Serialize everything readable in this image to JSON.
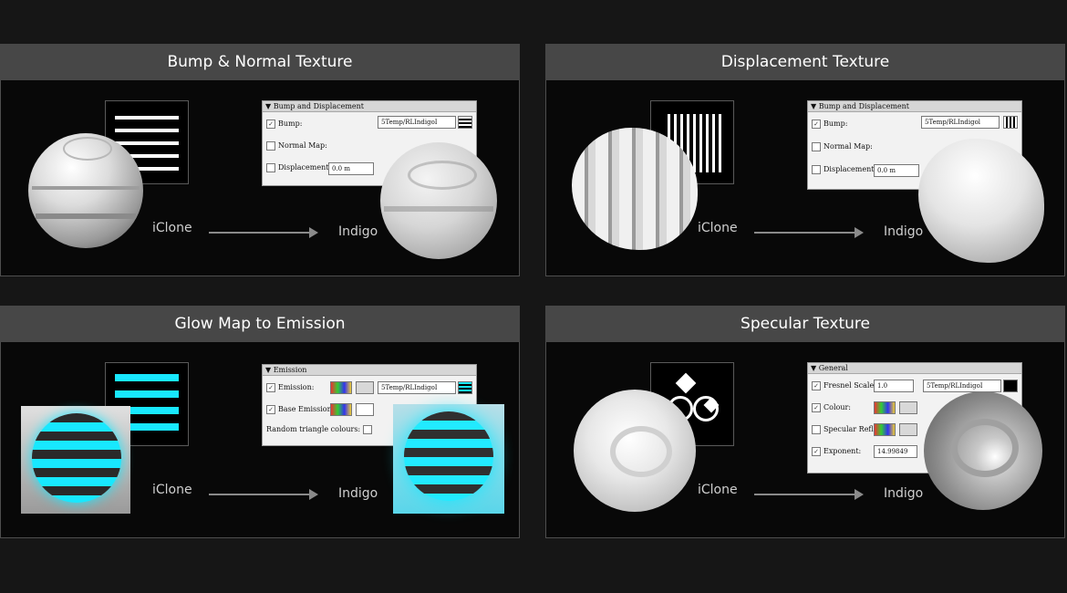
{
  "labels": {
    "from": "iClone",
    "to": "Indigo"
  },
  "panels": {
    "bump": {
      "title": "Bump & Normal Texture",
      "dialog": {
        "header": "Bump and Displacement",
        "rows": [
          {
            "label": "Bump:",
            "checked": true
          },
          {
            "label": "Normal Map:",
            "checked": false
          },
          {
            "label": "Displacement:",
            "checked": false
          }
        ],
        "path": "5Temp/RLIndigoI",
        "displacement_value": "0.0 m"
      }
    },
    "displacement": {
      "title": "Displacement Texture",
      "dialog": {
        "header": "Bump and Displacement",
        "rows": [
          {
            "label": "Bump:",
            "checked": true
          },
          {
            "label": "Normal Map:",
            "checked": false
          },
          {
            "label": "Displacement:",
            "checked": false
          }
        ],
        "path": "5Temp/RLIndigol",
        "displacement_value": "0.0 m"
      }
    },
    "glow": {
      "title": "Glow Map to Emission",
      "dialog": {
        "header": "Emission",
        "rows": [
          {
            "label": "Emission:",
            "checked": true
          },
          {
            "label": "Base Emission:",
            "checked": true
          },
          {
            "label": "Random triangle colours:",
            "checked": false
          }
        ],
        "path": "5Temp/RLIndigoI"
      }
    },
    "specular": {
      "title": "Specular Texture",
      "dialog": {
        "header": "General",
        "rows": [
          {
            "label": "Fresnel Scale:",
            "checked": true
          },
          {
            "label": "Colour:",
            "checked": true
          },
          {
            "label": "Specular Refl.:",
            "checked": false
          },
          {
            "label": "Exponent:",
            "checked": true
          }
        ],
        "fresnel_value": "1.0",
        "exponent_value": "14.99849",
        "path": "5Temp/RLIndigoI"
      }
    }
  },
  "colors": {
    "glow_accent": "#18e8ff",
    "header_bg": "#474747"
  }
}
